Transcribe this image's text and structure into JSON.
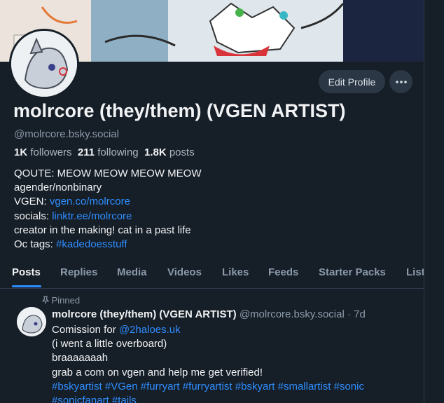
{
  "profile": {
    "display_name": "molrcore (they/them) (VGEN ARTIST)",
    "handle": "@molrcore.bsky.social",
    "edit_button": "Edit Profile",
    "more_button": "···",
    "stats": {
      "followers_count": "1K",
      "followers_label": "followers",
      "following_count": "211",
      "following_label": "following",
      "posts_count": "1.8K",
      "posts_label": "posts"
    },
    "bio": {
      "line1": "QOUTE: MEOW MEOW MEOW MEOW",
      "line2": "agender/nonbinary",
      "line3_prefix": "VGEN: ",
      "line3_link": "vgen.co/molrcore",
      "line4_prefix": "socials: ",
      "line4_link": "linktr.ee/molrcore",
      "line5": "creator in the making! cat in a past life",
      "line6_prefix": "Oc tags: ",
      "line6_link": "#kadedoesstuff"
    }
  },
  "tabs": [
    "Posts",
    "Replies",
    "Media",
    "Videos",
    "Likes",
    "Feeds",
    "Starter Packs",
    "List"
  ],
  "post": {
    "pinned_label": "Pinned",
    "author_name": "molrcore (they/them) (VGEN ARTIST)",
    "author_handle": "@molrcore.bsky.social",
    "separator": "·",
    "time": "7d",
    "line1_prefix": "Comission for ",
    "line1_mention": "@2haloes.uk",
    "line2": "(i went a little overboard)",
    "line3": "braaaaaaah",
    "line4": "grab a com on vgen and help me get verified!",
    "line5": "#bskyartist #VGen #furryart #furryartist #bskyart #smallartist #sonic",
    "line6": "#sonicfanart #tails"
  },
  "colors": {
    "background": "#161e27",
    "link": "#2f8eff",
    "muted": "#8c9aab",
    "button": "#2b3745"
  }
}
